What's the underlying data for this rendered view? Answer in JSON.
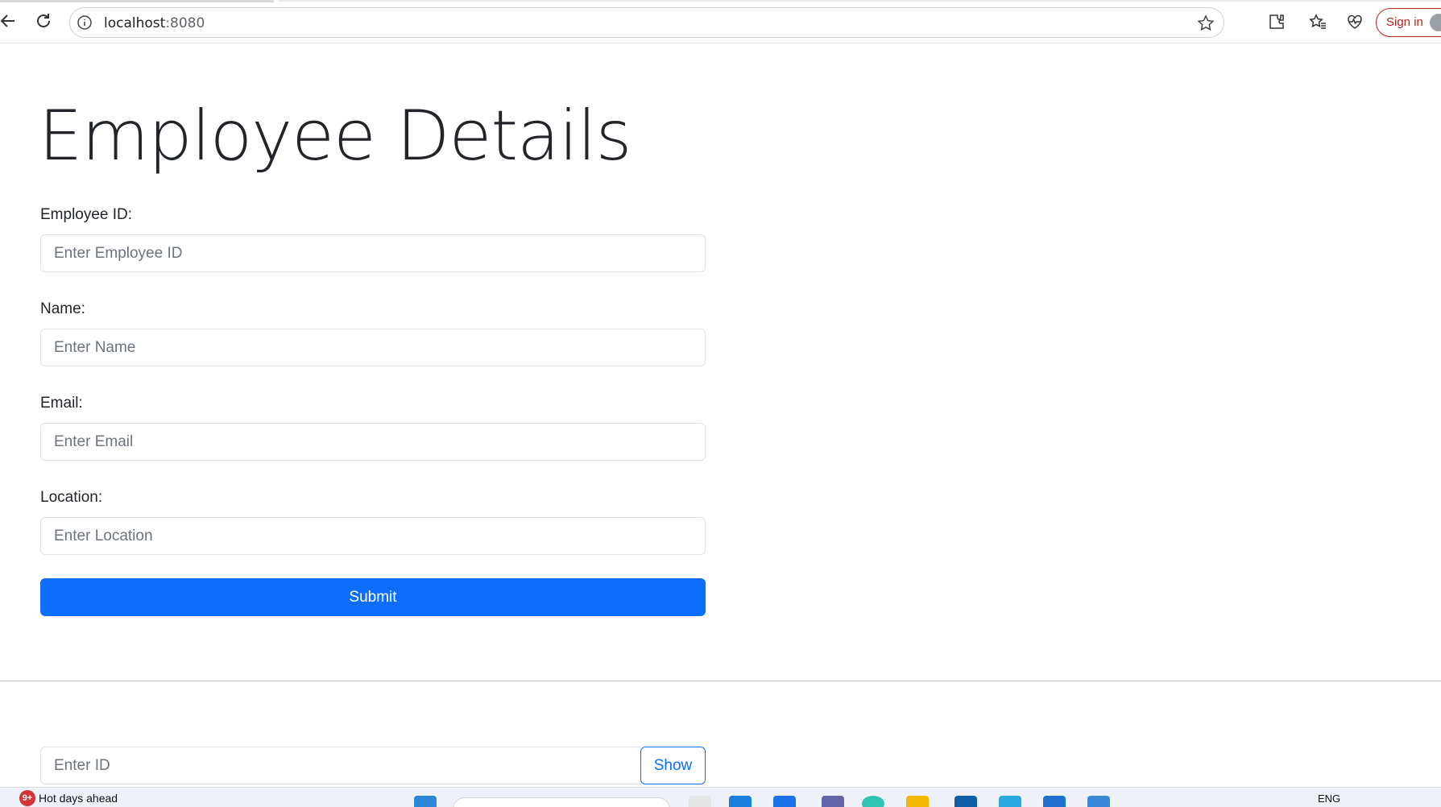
{
  "browser": {
    "url_host": "localhost",
    "url_port": ":8080",
    "signin_label": "Sign in"
  },
  "page": {
    "title": "Employee Details",
    "fields": [
      {
        "label": "Employee ID:",
        "placeholder": "Enter Employee ID"
      },
      {
        "label": "Name:",
        "placeholder": "Enter Name"
      },
      {
        "label": "Email:",
        "placeholder": "Enter Email"
      },
      {
        "label": "Location:",
        "placeholder": "Enter Location"
      }
    ],
    "submit_label": "Submit",
    "lookup": {
      "placeholder": "Enter ID",
      "button_label": "Show"
    }
  },
  "taskbar": {
    "weather_badge": "9+",
    "weather_text": "Hot days ahead",
    "language": "ENG"
  },
  "colors": {
    "primary": "#0d6efd",
    "signin": "#b3261e"
  }
}
